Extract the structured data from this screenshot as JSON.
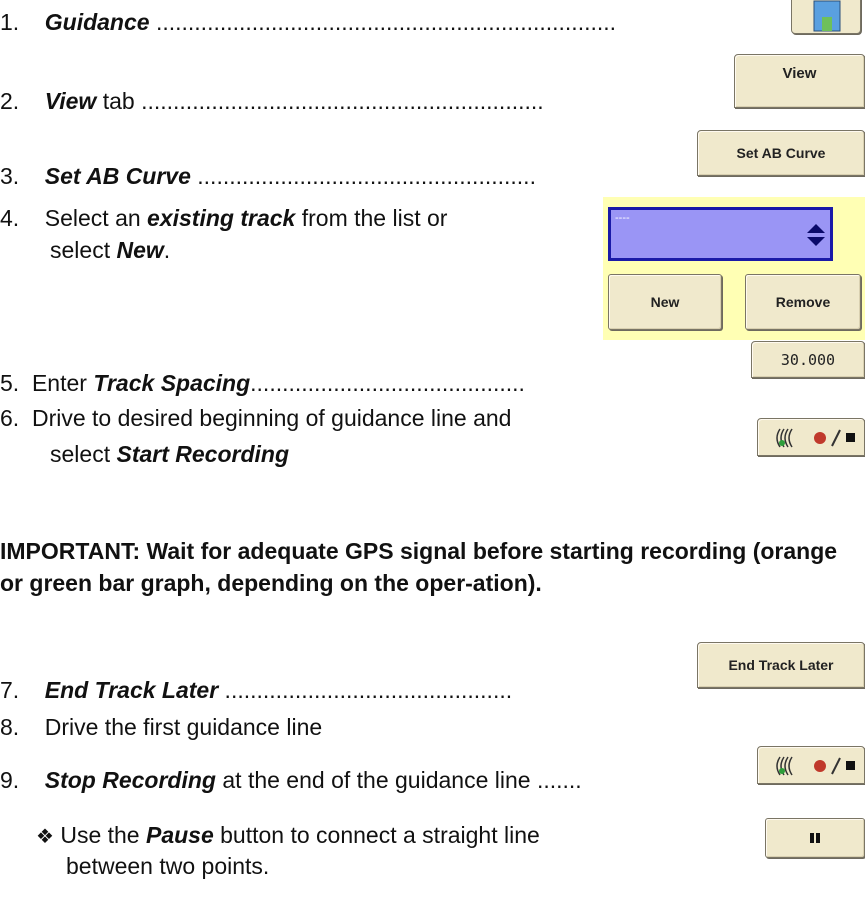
{
  "steps": [
    {
      "num": "1.",
      "emph": "Guidance",
      "dots": " ........................................................................"
    },
    {
      "num": "2.",
      "emph": "View",
      "after": " tab",
      "dots": " ..............................................................."
    },
    {
      "num": "3.",
      "emph": "Set AB Curve",
      "dots": " ....................................................."
    },
    {
      "num": "4.",
      "pre": " Select an ",
      "emph": "existing track",
      "after": " from the list or",
      "line2_pre": "select ",
      "line2_emph": "New",
      "line2_after": "."
    },
    {
      "num": "5.",
      "pre": "Enter ",
      "emph": "Track Spacing",
      "dots": "..........................................."
    },
    {
      "num": "6.",
      "pre": "Drive to desired beginning of guidance line and",
      "line2_pre": "select ",
      "line2_emph": "Start Recording"
    },
    {
      "num": "7.",
      "emph": "End Track Later",
      "dots": " ............................................."
    },
    {
      "num": "8.",
      "pre": " Drive the first guidance line"
    },
    {
      "num": "9.",
      "emph": "Stop Recording",
      "after": " at the end of the guidance line",
      "dots": " ......."
    }
  ],
  "important": "IMPORTANT: Wait for adequate GPS signal before starting recording (orange or green bar graph, depending on the oper-ation).",
  "note": {
    "bullet": "❖",
    "pre": "Use the ",
    "emph": "Pause",
    "after": " button to connect a straight line",
    "line2": "between two points."
  },
  "buttons": {
    "view": "View",
    "set_ab_curve": "Set AB Curve",
    "new": "New",
    "remove": "Remove",
    "track_spacing_value": "30.000",
    "end_track_later": "End Track Later",
    "pause_icon": "pause-icon",
    "record_icon": "record-stop-icon"
  },
  "track_select": {
    "value": "----"
  },
  "colors": {
    "button_bg": "#f0e9cc",
    "panel_bg": "#ffffb4",
    "select_bg": "#9a95f5",
    "select_border": "#1a1aa8",
    "record_dot": "#c0392b",
    "gps_green": "#2e9e3a"
  }
}
